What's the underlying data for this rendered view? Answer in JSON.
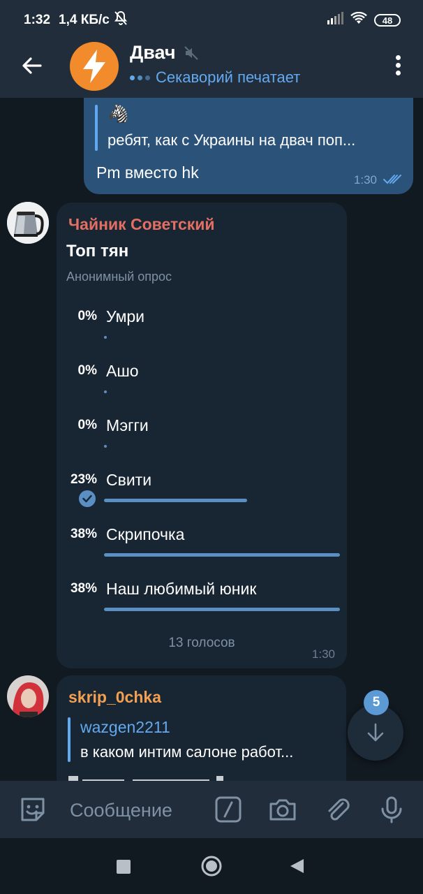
{
  "status_bar": {
    "time": "1:32",
    "speed": "1,4 КБ/с",
    "battery": "48"
  },
  "header": {
    "title": "Двач",
    "status": "Секаворий печатает"
  },
  "outgoing_message": {
    "reply_emoji": "🦓",
    "reply_text": "ребят, как с Украины на двач поп...",
    "text": "Pm вместо hk",
    "time": "1:30"
  },
  "poll_message": {
    "sender": "Чайник Советский",
    "question": "Топ тян",
    "poll_type": "Анонимный опрос",
    "options": [
      {
        "percent": "0%",
        "label": "Умри",
        "value": 0,
        "voted": false
      },
      {
        "percent": "0%",
        "label": "Ашо",
        "value": 0,
        "voted": false
      },
      {
        "percent": "0%",
        "label": "Мэгги",
        "value": 0,
        "voted": false
      },
      {
        "percent": "23%",
        "label": "Свити",
        "value": 23,
        "voted": true
      },
      {
        "percent": "38%",
        "label": "Скрипочка",
        "value": 38,
        "voted": false
      },
      {
        "percent": "38%",
        "label": "Наш любимый юник",
        "value": 38,
        "voted": false
      }
    ],
    "votes": "13 голосов",
    "time": "1:30"
  },
  "next_message": {
    "sender": "skrip_0chka",
    "reply_name": "wazgen2211",
    "reply_text": "в каком интим салоне работ..."
  },
  "scroll_fab": {
    "unread_count": "5"
  },
  "composer": {
    "placeholder": "Сообщение"
  },
  "icons": {
    "back": "arrow-left-icon",
    "mute": "muted-speaker-icon",
    "menu": "more-vertical-icon",
    "emoji": "sticker-icon",
    "command": "slash-command-icon",
    "camera": "camera-icon",
    "attach": "paperclip-icon",
    "mic": "microphone-icon"
  },
  "colors": {
    "accent": "#63a9ef",
    "header_bg": "#212d3b",
    "chat_bg": "#111921",
    "out_bubble": "#2b5278",
    "in_bubble": "#182533",
    "sender_red": "#e36f63",
    "sender_orange": "#f2a051"
  }
}
